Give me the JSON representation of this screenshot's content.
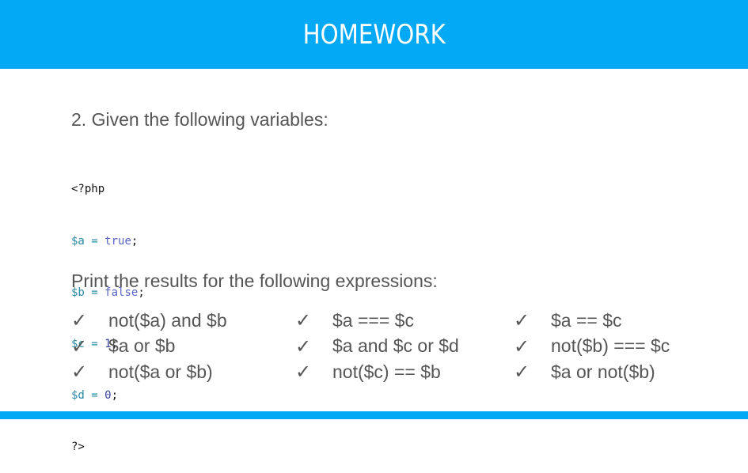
{
  "header": {
    "title": "HOMEWORK",
    "color": "#03a9f4"
  },
  "intro_text": "2. Given the following variables:",
  "code": {
    "open_tag": "<?php",
    "lines": [
      {
        "var": "$a",
        "op": " = ",
        "val": "true",
        "end": ";"
      },
      {
        "var": "$b",
        "op": " = ",
        "val": "false",
        "end": ";"
      },
      {
        "var": "$c",
        "op": " = ",
        "val": "1",
        "end": ";"
      },
      {
        "var": "$d",
        "op": " = ",
        "val": "0",
        "end": ";"
      }
    ],
    "close_tag": "?>"
  },
  "subhead": "Print the results for the following expressions:",
  "check_glyph": "✓",
  "expressions": [
    [
      "not($a) and $b",
      "$a or $b",
      "not($a or $b)"
    ],
    [
      "$a === $c",
      "$a and $c or $d",
      "not($c) == $b"
    ],
    [
      "$a == $c",
      "not($b) === $c",
      "$a or not($b)"
    ]
  ]
}
